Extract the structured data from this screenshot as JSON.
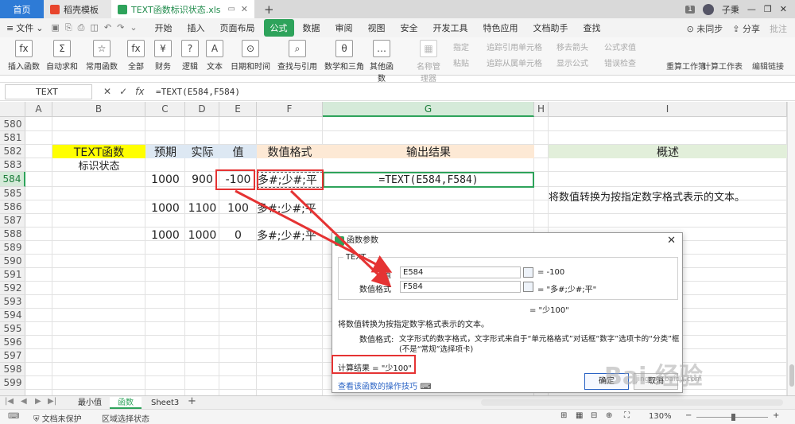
{
  "titlebar": {
    "home_tab": "首页",
    "daoke_tab": "稻壳模板",
    "file_tab": "TEXT函数标识状态.xls",
    "page_num": "1",
    "user": "子秉"
  },
  "menubar": {
    "file": "文件",
    "items": [
      "开始",
      "插入",
      "页面布局",
      "公式",
      "数据",
      "审阅",
      "视图",
      "安全",
      "开发工具",
      "特色应用",
      "文档助手",
      "查找"
    ],
    "active_index": 3,
    "sync": "未同步",
    "share": "分享",
    "annotate": "批注"
  },
  "ribbon": {
    "buttons": [
      "插入函数",
      "自动求和",
      "常用函数",
      "全部",
      "财务",
      "逻辑",
      "文本",
      "日期和时间",
      "查找与引用",
      "数学和三角",
      "其他函数",
      "名称管理器"
    ],
    "icons": [
      "fx",
      "Σ",
      "☆",
      "fx",
      "¥",
      "?",
      "A",
      "⊙",
      "⌕",
      "θ",
      "…",
      "▦"
    ],
    "small": [
      "指定",
      "粘贴",
      "追踪引用单元格",
      "追踪从属单元格",
      "移去箭头",
      "显示公式",
      "公式求值",
      "错误检查",
      "重算工作簿",
      "计算工作表",
      "编辑链接"
    ]
  },
  "formula_bar": {
    "name_box": "TEXT",
    "formula": "=TEXT(E584,F584)"
  },
  "columns": [
    "A",
    "B",
    "C",
    "D",
    "E",
    "F",
    "G",
    "H",
    "I"
  ],
  "rows": [
    "580",
    "581",
    "582",
    "583",
    "584",
    "585",
    "586",
    "587",
    "588",
    "589",
    "590",
    "591",
    "592",
    "593",
    "594",
    "595",
    "596",
    "597",
    "598",
    "599"
  ],
  "cells": {
    "b582": "TEXT函数",
    "b583": "标识状态",
    "c582": "预期",
    "d582": "实际",
    "e582": "值",
    "f582": "数值格式",
    "g582": "输出结果",
    "i582": "概述",
    "c584": "1000",
    "d584": "900",
    "e584": "-100",
    "f584": "多#;少#;平",
    "g584": "=TEXT(E584,F584)",
    "i585": "将数值转换为按指定数字格式表示的文本。",
    "c586": "1000",
    "d586": "1100",
    "e586": "100",
    "f586": "多#;少#;平",
    "c588": "1000",
    "d588": "1000",
    "e588": "0",
    "f588": "多#;少#;平"
  },
  "colors": {
    "header_yellow": "#ffff00",
    "header_blue": "#dde8f3",
    "header_peach": "#fde9d5",
    "header_green": "#e2efda",
    "accent_green": "#2ea35b",
    "annotation_red": "#e53333"
  },
  "sheet_tabs": [
    "最小值",
    "函数",
    "Sheet3"
  ],
  "active_sheet_index": 1,
  "status": {
    "protect": "文档未保护",
    "region": "区域选择状态",
    "zoom": "130%"
  },
  "dialog": {
    "title": "函数参数",
    "function_name": "TEXT",
    "arg1_label": "值",
    "arg1_input": "E584",
    "arg1_value": "= -100",
    "arg2_label": "数值格式",
    "arg2_input": "F584",
    "arg2_value": "= \"多#;少#;平\"",
    "result_line": "= \"少100\"",
    "description": "将数值转换为按指定数字格式表示的文本。",
    "arg_desc_label": "数值格式:",
    "arg_desc_1": "文字形式的数字格式，文字形式来自于“单元格格式”对话框“数字”选项卡的“分类”框",
    "arg_desc_2": "(不是“常规”选择项卡)",
    "calc_result": "计算结果 = \"少100\"",
    "help_link": "查看该函数的操作技巧",
    "ok": "确定",
    "cancel": "取消"
  },
  "watermark": {
    "text": "Bai 经验",
    "sub": "jingyan.baidu.com"
  }
}
